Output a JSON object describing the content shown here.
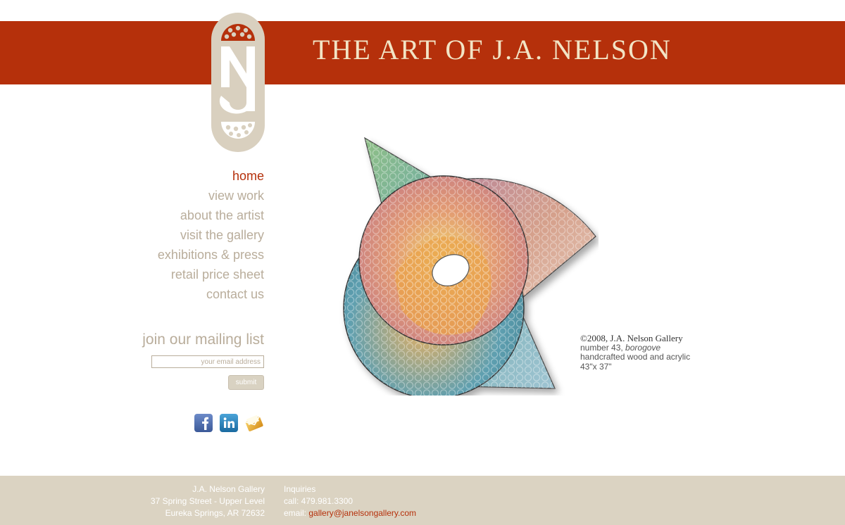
{
  "header": {
    "site_title": "THE ART OF J.A. NELSON",
    "logo_letters": "JAN",
    "colors": {
      "banner": "#b5300b",
      "title": "#f2e4c5",
      "logo": "#d9d0bf"
    }
  },
  "nav": {
    "items": [
      {
        "label": "home",
        "active": true
      },
      {
        "label": "view work",
        "active": false
      },
      {
        "label": "about the artist",
        "active": false
      },
      {
        "label": "visit the gallery",
        "active": false
      },
      {
        "label": "exhibitions & press",
        "active": false
      },
      {
        "label": "retail price sheet",
        "active": false
      },
      {
        "label": "contact us",
        "active": false
      }
    ]
  },
  "mailing": {
    "title": "join our mailing list",
    "input_placeholder": "your email address",
    "input_value": "",
    "submit_label": "submit"
  },
  "social": [
    {
      "icon": "facebook-icon",
      "glyph": "f",
      "color": "#3b5998"
    },
    {
      "icon": "linkedin-icon",
      "glyph": "in",
      "color": "#1d78b5"
    },
    {
      "icon": "email-icon",
      "glyph": "✉",
      "color": "#e3a526"
    }
  ],
  "artwork": {
    "caption": {
      "copyright": "©2008, J.A. Nelson Gallery",
      "number_prefix": "number 43, ",
      "title": "borogove",
      "medium": "handcrafted wood and acrylic",
      "dimensions": "43\"x 37\""
    }
  },
  "footer": {
    "address": {
      "name": "J.A. Nelson Gallery",
      "street": "37 Spring Street - Upper Level",
      "city": "Eureka Springs, AR 72632"
    },
    "contact": {
      "heading": "Inquiries",
      "phone": "call: 479.981.3300",
      "email_label": "email: ",
      "email": "gallery@janelsongallery.com"
    },
    "colors": {
      "background": "#dbd3c2",
      "link": "#b5300b"
    }
  }
}
